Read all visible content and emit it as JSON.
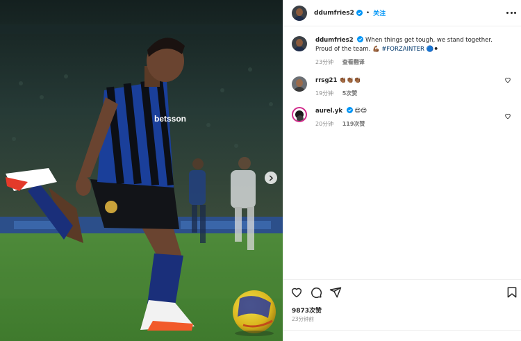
{
  "colors": {
    "accent": "#0095f6",
    "muted": "#8e8e8e",
    "text": "#262626"
  },
  "post": {
    "navigation": {
      "next_icon": "chevron-right-icon"
    },
    "header": {
      "username": "ddumfries2",
      "separator": "•",
      "follow_label": "关注",
      "more_icon": "more-horizontal-icon"
    },
    "caption": {
      "username": "ddumfries2",
      "text": "When things get tough, we stand together. Proud of the team. 💪🏾",
      "hashtag": "#FORZAINTER",
      "trailing_emojis": "🔵⚫",
      "time": "23分钟",
      "translate_label": "查看翻译"
    },
    "comments": [
      {
        "username": "rrsg21",
        "text": "👏🏾👏🏾👏🏾",
        "time": "19分钟",
        "likes": "5次赞"
      },
      {
        "username": "aurel.yk",
        "text": "😍😍",
        "time": "20分钟",
        "likes": "119次赞"
      }
    ],
    "likes_count": "9873次赞",
    "posted_ago": "23分钟前",
    "action_icons": [
      "heart-icon",
      "comment-icon",
      "share-icon",
      "bookmark-icon"
    ]
  }
}
